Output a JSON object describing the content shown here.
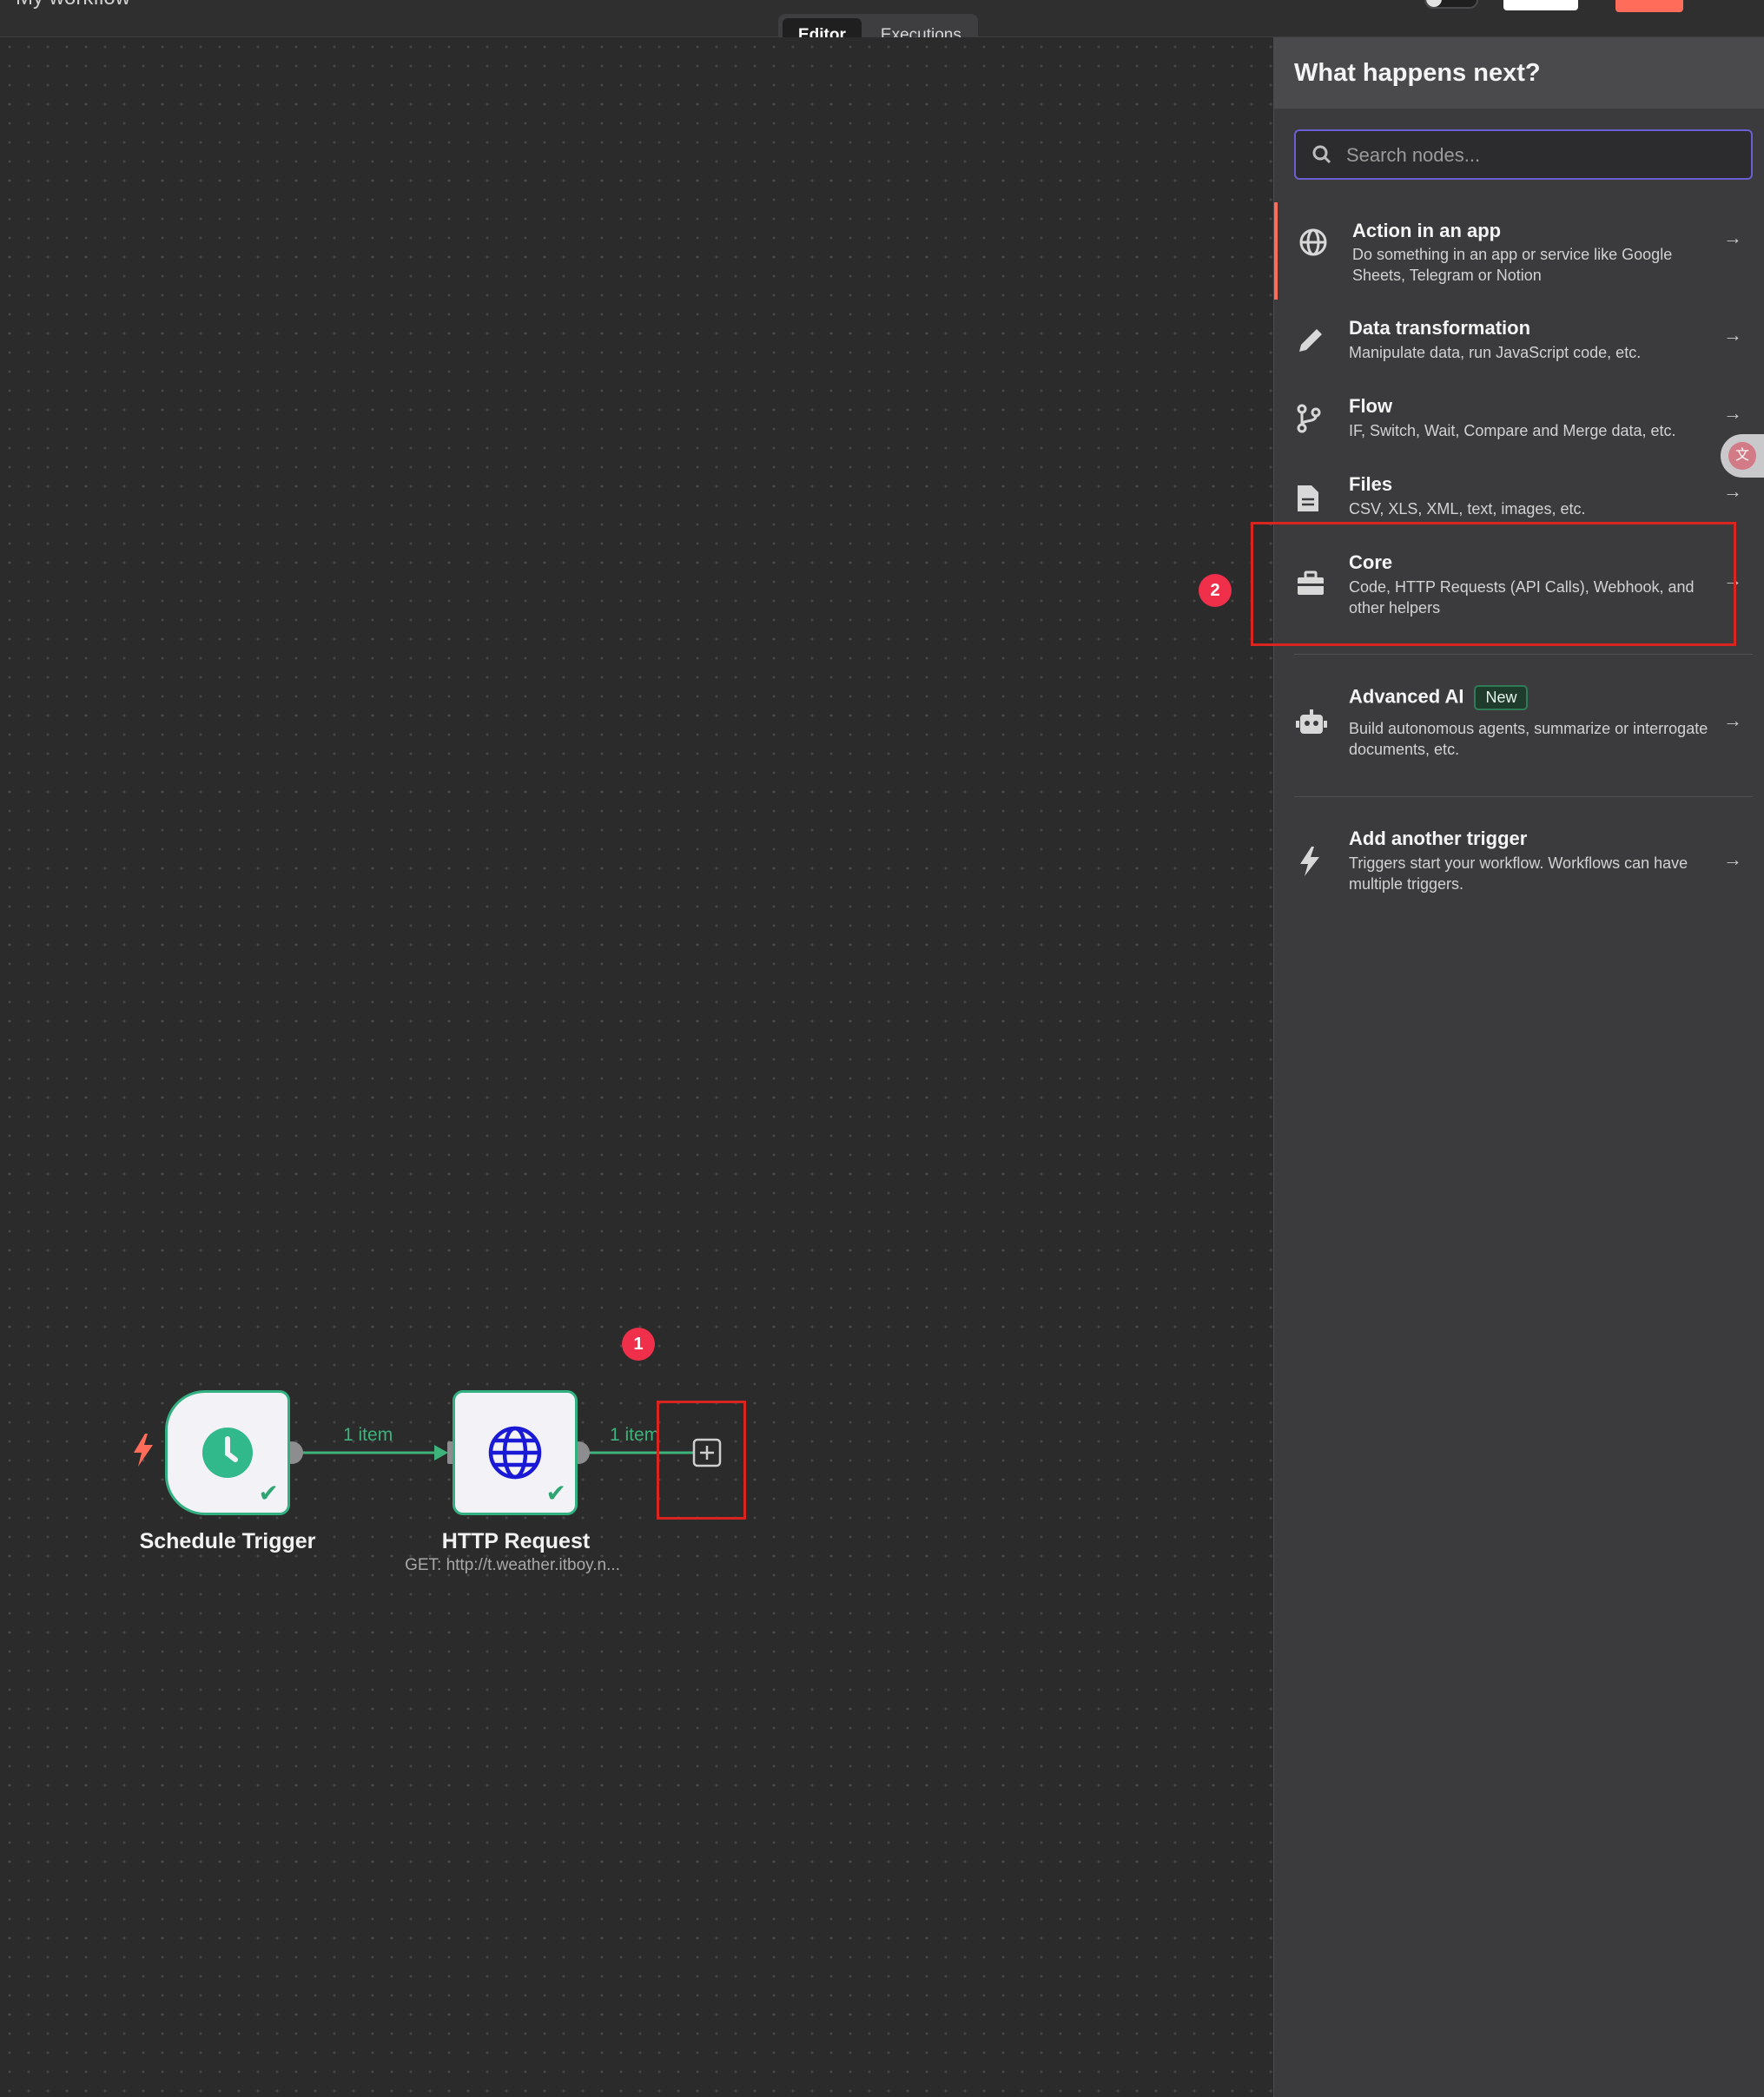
{
  "topbar": {
    "workflow_name": "My workflow",
    "tabs": [
      {
        "label": "Editor",
        "active": true
      },
      {
        "label": "Executions",
        "active": false
      }
    ]
  },
  "canvas": {
    "nodes": {
      "schedule_trigger": {
        "label": "Schedule Trigger",
        "icon": "clock-icon"
      },
      "http_request": {
        "label": "HTTP Request",
        "subtitle": "GET: http://t.weather.itboy.n...",
        "icon": "globe-icon"
      }
    },
    "edges": {
      "edge1_label": "1 item",
      "edge2_label": "1 item"
    },
    "add_node_icon": "plus-box-icon",
    "annotations": {
      "badge1": "1",
      "badge2": "2"
    }
  },
  "panel": {
    "title": "What happens next?",
    "search_placeholder": "Search nodes...",
    "categories": [
      {
        "title": "Action in an app",
        "description": "Do something in an app or service like Google Sheets, Telegram or Notion",
        "icon": "globe-icon"
      },
      {
        "title": "Data transformation",
        "description": "Manipulate data, run JavaScript code, etc.",
        "icon": "pencil-icon"
      },
      {
        "title": "Flow",
        "description": "IF, Switch, Wait, Compare and Merge data, etc.",
        "icon": "branch-icon"
      },
      {
        "title": "Files",
        "description": "CSV, XLS, XML, text, images, etc.",
        "icon": "file-icon"
      },
      {
        "title": "Core",
        "description": "Code, HTTP Requests (API Calls), Webhook, and other helpers",
        "icon": "toolbox-icon"
      },
      {
        "title": "Advanced AI",
        "badge": "New",
        "description": "Build autonomous agents, summarize or interrogate documents, etc.",
        "icon": "robot-icon"
      },
      {
        "title": "Add another trigger",
        "description": "Triggers start your workflow. Workflows can have multiple triggers.",
        "icon": "bolt-icon"
      }
    ]
  },
  "colors": {
    "accent": "#ff6d5a",
    "success": "#33b081",
    "annotation_red": "#d9251f",
    "badge_red": "#f0304a"
  }
}
